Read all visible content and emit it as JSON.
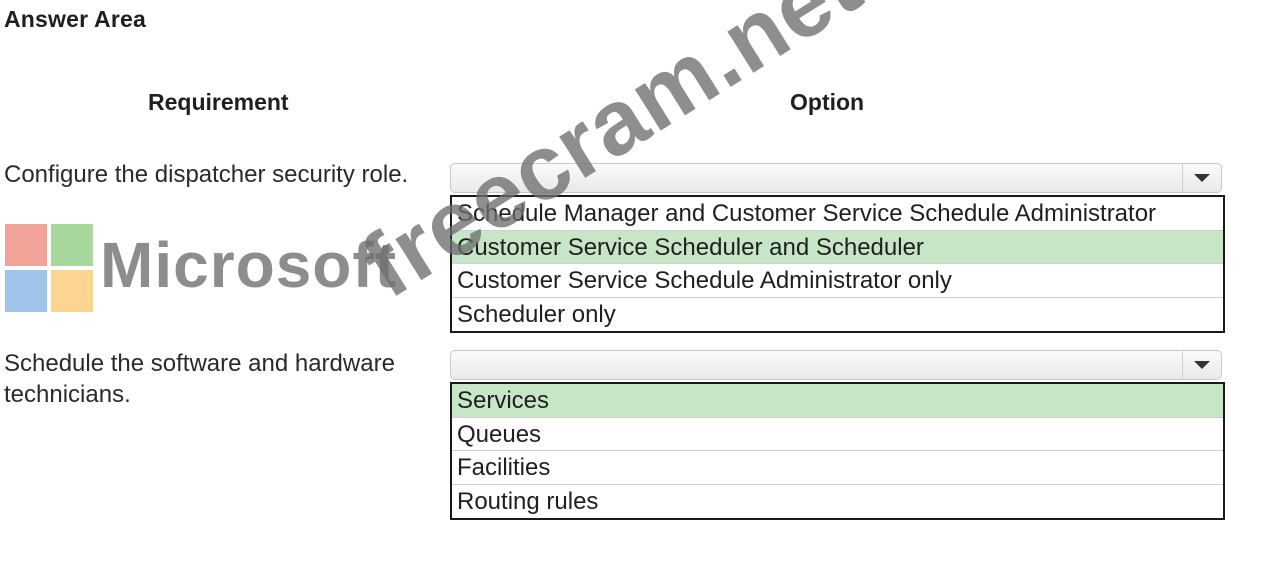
{
  "header": {
    "title": "Answer Area"
  },
  "columns": {
    "requirement": "Requirement",
    "option": "Option"
  },
  "rows": [
    {
      "requirement": "Configure the dispatcher security role.",
      "options": [
        "Schedule Manager and Customer Service Schedule Administrator",
        "Customer Service Scheduler and Scheduler",
        "Customer Service Schedule Administrator only",
        "Scheduler only"
      ],
      "selected_index": 1
    },
    {
      "requirement": "Schedule the software and hardware technicians.",
      "options": [
        "Services",
        "Queues",
        "Facilities",
        "Routing rules"
      ],
      "selected_index": 0
    }
  ],
  "logo": {
    "text": "Microsoft"
  },
  "watermark": {
    "text": "freecram.net"
  },
  "colors": {
    "selected_bg": "#c6e6c6",
    "list_border": "#1a1a1a"
  },
  "icons": {
    "dropdown": "chevron-down-icon",
    "logo": "microsoft-logo-icon"
  }
}
